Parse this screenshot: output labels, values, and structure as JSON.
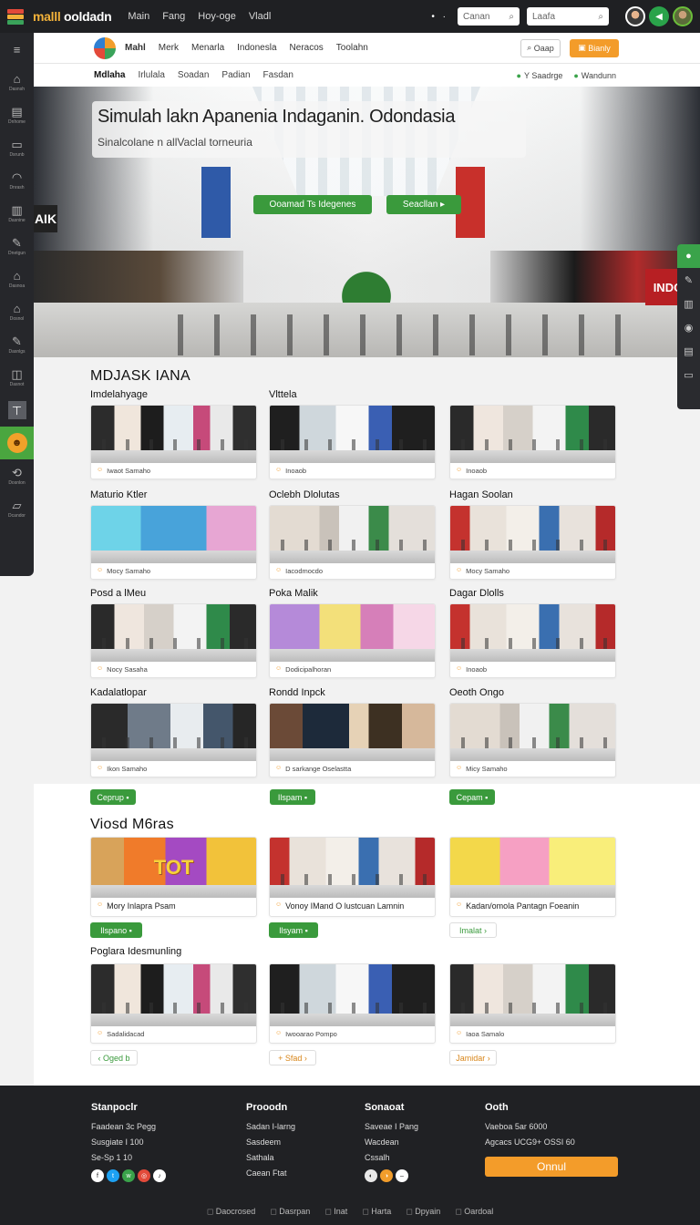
{
  "topbar": {
    "brand_a": "malll",
    "brand_b": "ooldadn",
    "nav": [
      "Main",
      "Fang",
      "Hoy-oge",
      "Vladl"
    ],
    "search1": "Canan",
    "search2": "Laafa"
  },
  "sidebar": {
    "items": [
      {
        "glyph": "≡",
        "label": ""
      },
      {
        "glyph": "⌂",
        "label": "Dasnsh"
      },
      {
        "glyph": "▤",
        "label": "Dnhome"
      },
      {
        "glyph": "▭",
        "label": "Dsrunb"
      },
      {
        "glyph": "◠",
        "label": "Dnrash"
      },
      {
        "glyph": "▥",
        "label": "Dasnine"
      },
      {
        "glyph": "✎",
        "label": "Dnetgun"
      },
      {
        "glyph": "⌂",
        "label": "Dasnoa"
      },
      {
        "glyph": "⌂",
        "label": "Dosnol"
      },
      {
        "glyph": "✎",
        "label": "Dasnlgs"
      },
      {
        "glyph": "◫",
        "label": "Dasnot"
      },
      {
        "glyph": "⊤",
        "label": ""
      },
      {
        "glyph": "☻",
        "label": ""
      },
      {
        "glyph": "⟲",
        "label": "Dosnlon"
      },
      {
        "glyph": "▱",
        "label": "Dcandor"
      }
    ]
  },
  "subnav": {
    "items": [
      "Mahl",
      "Merk",
      "Menarla",
      "Indonesla",
      "Neracos",
      "Toolahn"
    ],
    "search": "Oaap",
    "button": "Bianly"
  },
  "tabs": {
    "left": [
      "Mdlaha",
      "Irlulala",
      "Soadan",
      "Padian",
      "Fasdan"
    ],
    "right": [
      "Y Saadrge",
      "Wandunn"
    ]
  },
  "hero": {
    "title": "Simulah lakn Apanenia Indaganin. Odondasia",
    "subtitle": "Sinalcolane n allVaclal torneuria",
    "btn1": "Ooamad Ts Idegenes",
    "btn2": "Seacllan",
    "sign_right": "INDOO",
    "sign_left": "AIK"
  },
  "listing": {
    "title": "MDJASK IANA",
    "rows": [
      [
        {
          "title": "Imdelahyage",
          "caption": "Iwaot Samaho"
        },
        {
          "title": "Vlttela",
          "caption": "Inoaob"
        },
        {
          "title": "",
          "caption": "Inoaob"
        }
      ],
      [
        {
          "title": "Maturio Ktler",
          "caption": "Mocy Samaho"
        },
        {
          "title": "Oclebh Dlolutas",
          "caption": "Iacodmocdo"
        },
        {
          "title": "Hagan Soolan",
          "caption": "Mocy Samaho"
        }
      ],
      [
        {
          "title": "Posd a lMeu",
          "caption": "Nocy Sasaha"
        },
        {
          "title": "Poka Malik",
          "caption": "Dodicipalhoran"
        },
        {
          "title": "Dagar Dlolls",
          "caption": "Inoaob"
        }
      ],
      [
        {
          "title": "Kadalatlopar",
          "caption": "Ikon Samaho"
        },
        {
          "title": "Rondd Inpck",
          "caption": "D sarkange Oselastta"
        },
        {
          "title": "Oeoth Ongo",
          "caption": "Micy Samaho"
        }
      ]
    ],
    "pills": [
      "Ceprup",
      "Ilspam",
      "Cepam"
    ]
  },
  "videos": {
    "title": "Viosd M6ras",
    "cards": [
      {
        "caption": "Mory Inlapra Psam"
      },
      {
        "caption": "Vonoy IMand O lustcuan Lamnin"
      },
      {
        "caption": "Kadan/omola Pantagn Foeanin"
      }
    ],
    "pills": [
      "Ilspano",
      "Ilsyam",
      "Imalat"
    ],
    "overlay_tot": "TOT"
  },
  "popular": {
    "title": "Poglara Idesmunling",
    "cards": [
      {
        "caption": "Sadalidacad"
      },
      {
        "caption": "Iwooarao Pompo"
      },
      {
        "caption": "Iaoa Samalo"
      }
    ],
    "pills": [
      "Oged b",
      "Sfad",
      "Jamidar"
    ]
  },
  "footer": {
    "col1": {
      "head": "Stanpoclr",
      "lines": [
        "Faadean 3c Pegg",
        "Susgiate I 100",
        "Se-Sp 1 10"
      ]
    },
    "col2": {
      "head": "Prooodn",
      "lines": [
        "Sadan I-larng",
        "Sasdeem",
        "Sathala",
        "Caean Ftat"
      ]
    },
    "col3": {
      "head": "Sonaoat",
      "lines": [
        "Saveae I Pang",
        "Wacdean",
        "Cssalh"
      ]
    },
    "col4": {
      "head": "Ooth",
      "lines": [
        "Vaeboa 5ar 6000",
        "Agcacs UCG9+ OSSI 60"
      ]
    },
    "button": "Onnul",
    "bottom": [
      "Daocrosed",
      "Dasrpan",
      "Inat",
      "Harta",
      "Dpyain",
      "Oardoal"
    ]
  }
}
